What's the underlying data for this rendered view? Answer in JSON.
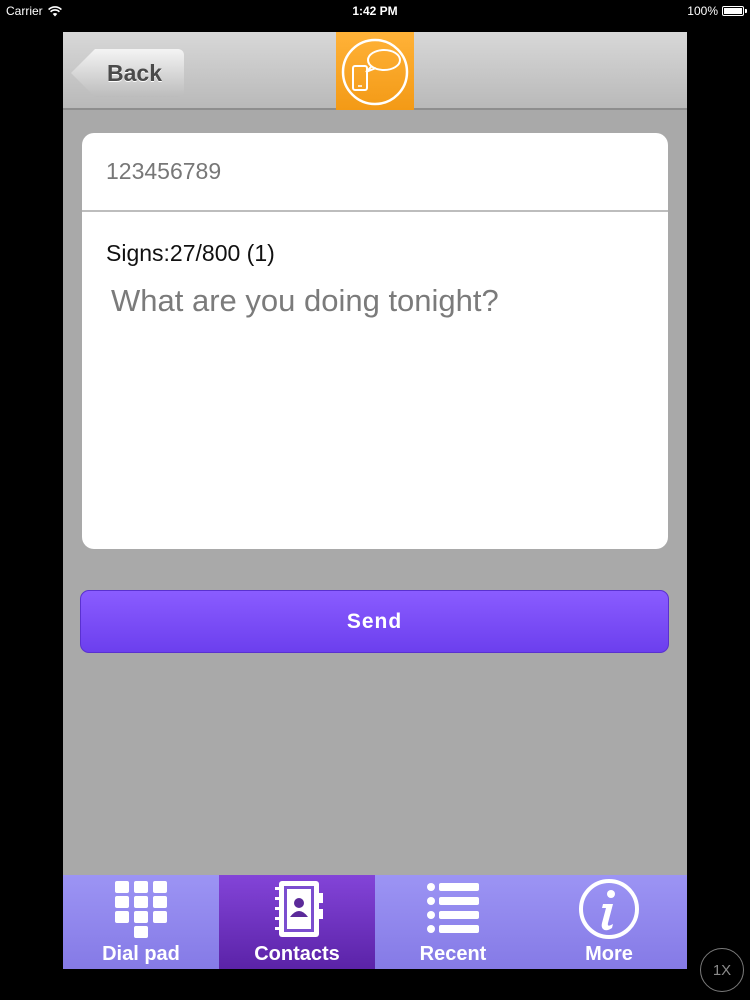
{
  "status_bar": {
    "carrier": "Carrier",
    "time": "1:42 PM",
    "battery": "100%"
  },
  "nav": {
    "back_label": "Back",
    "logo_icon": "message-bubble-phone-icon",
    "logo_color": "#f7a21b"
  },
  "message": {
    "phone_number": "123456789",
    "signs_counter": "Signs:27/800 (1)",
    "body": "What are you doing tonight?"
  },
  "send_button": {
    "label": "Send",
    "color": "#7446f2"
  },
  "tabs": [
    {
      "label": "Dial pad",
      "icon": "dial-pad-icon",
      "active": false
    },
    {
      "label": "Contacts",
      "icon": "contacts-book-icon",
      "active": true
    },
    {
      "label": "Recent",
      "icon": "list-icon",
      "active": false
    },
    {
      "label": "More",
      "icon": "info-icon",
      "active": false
    }
  ],
  "zoom_badge": "1X"
}
